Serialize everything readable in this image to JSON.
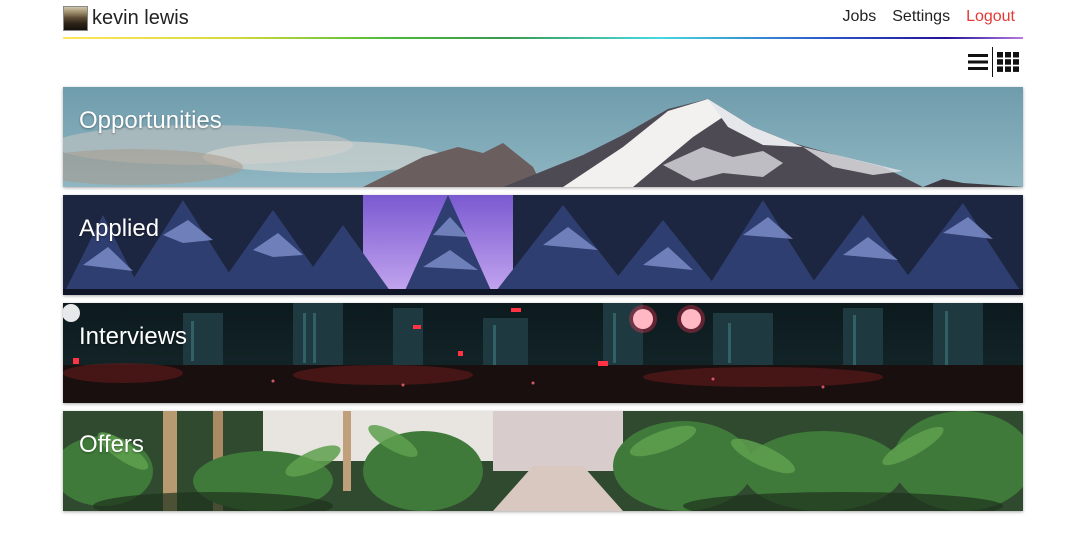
{
  "header": {
    "user_name": "kevin lewis",
    "nav": {
      "jobs": "Jobs",
      "settings": "Settings",
      "logout": "Logout"
    }
  },
  "toolbar": {
    "list_view_icon": "list-icon",
    "grid_view_icon": "grid-icon"
  },
  "colors": {
    "logout": "#e53935"
  },
  "cards": [
    {
      "title": "Opportunities",
      "scene": "snowy-mountain"
    },
    {
      "title": "Applied",
      "scene": "snowy-pine-forest"
    },
    {
      "title": "Interviews",
      "scene": "night-city"
    },
    {
      "title": "Offers",
      "scene": "tropical-greenhouse"
    }
  ]
}
